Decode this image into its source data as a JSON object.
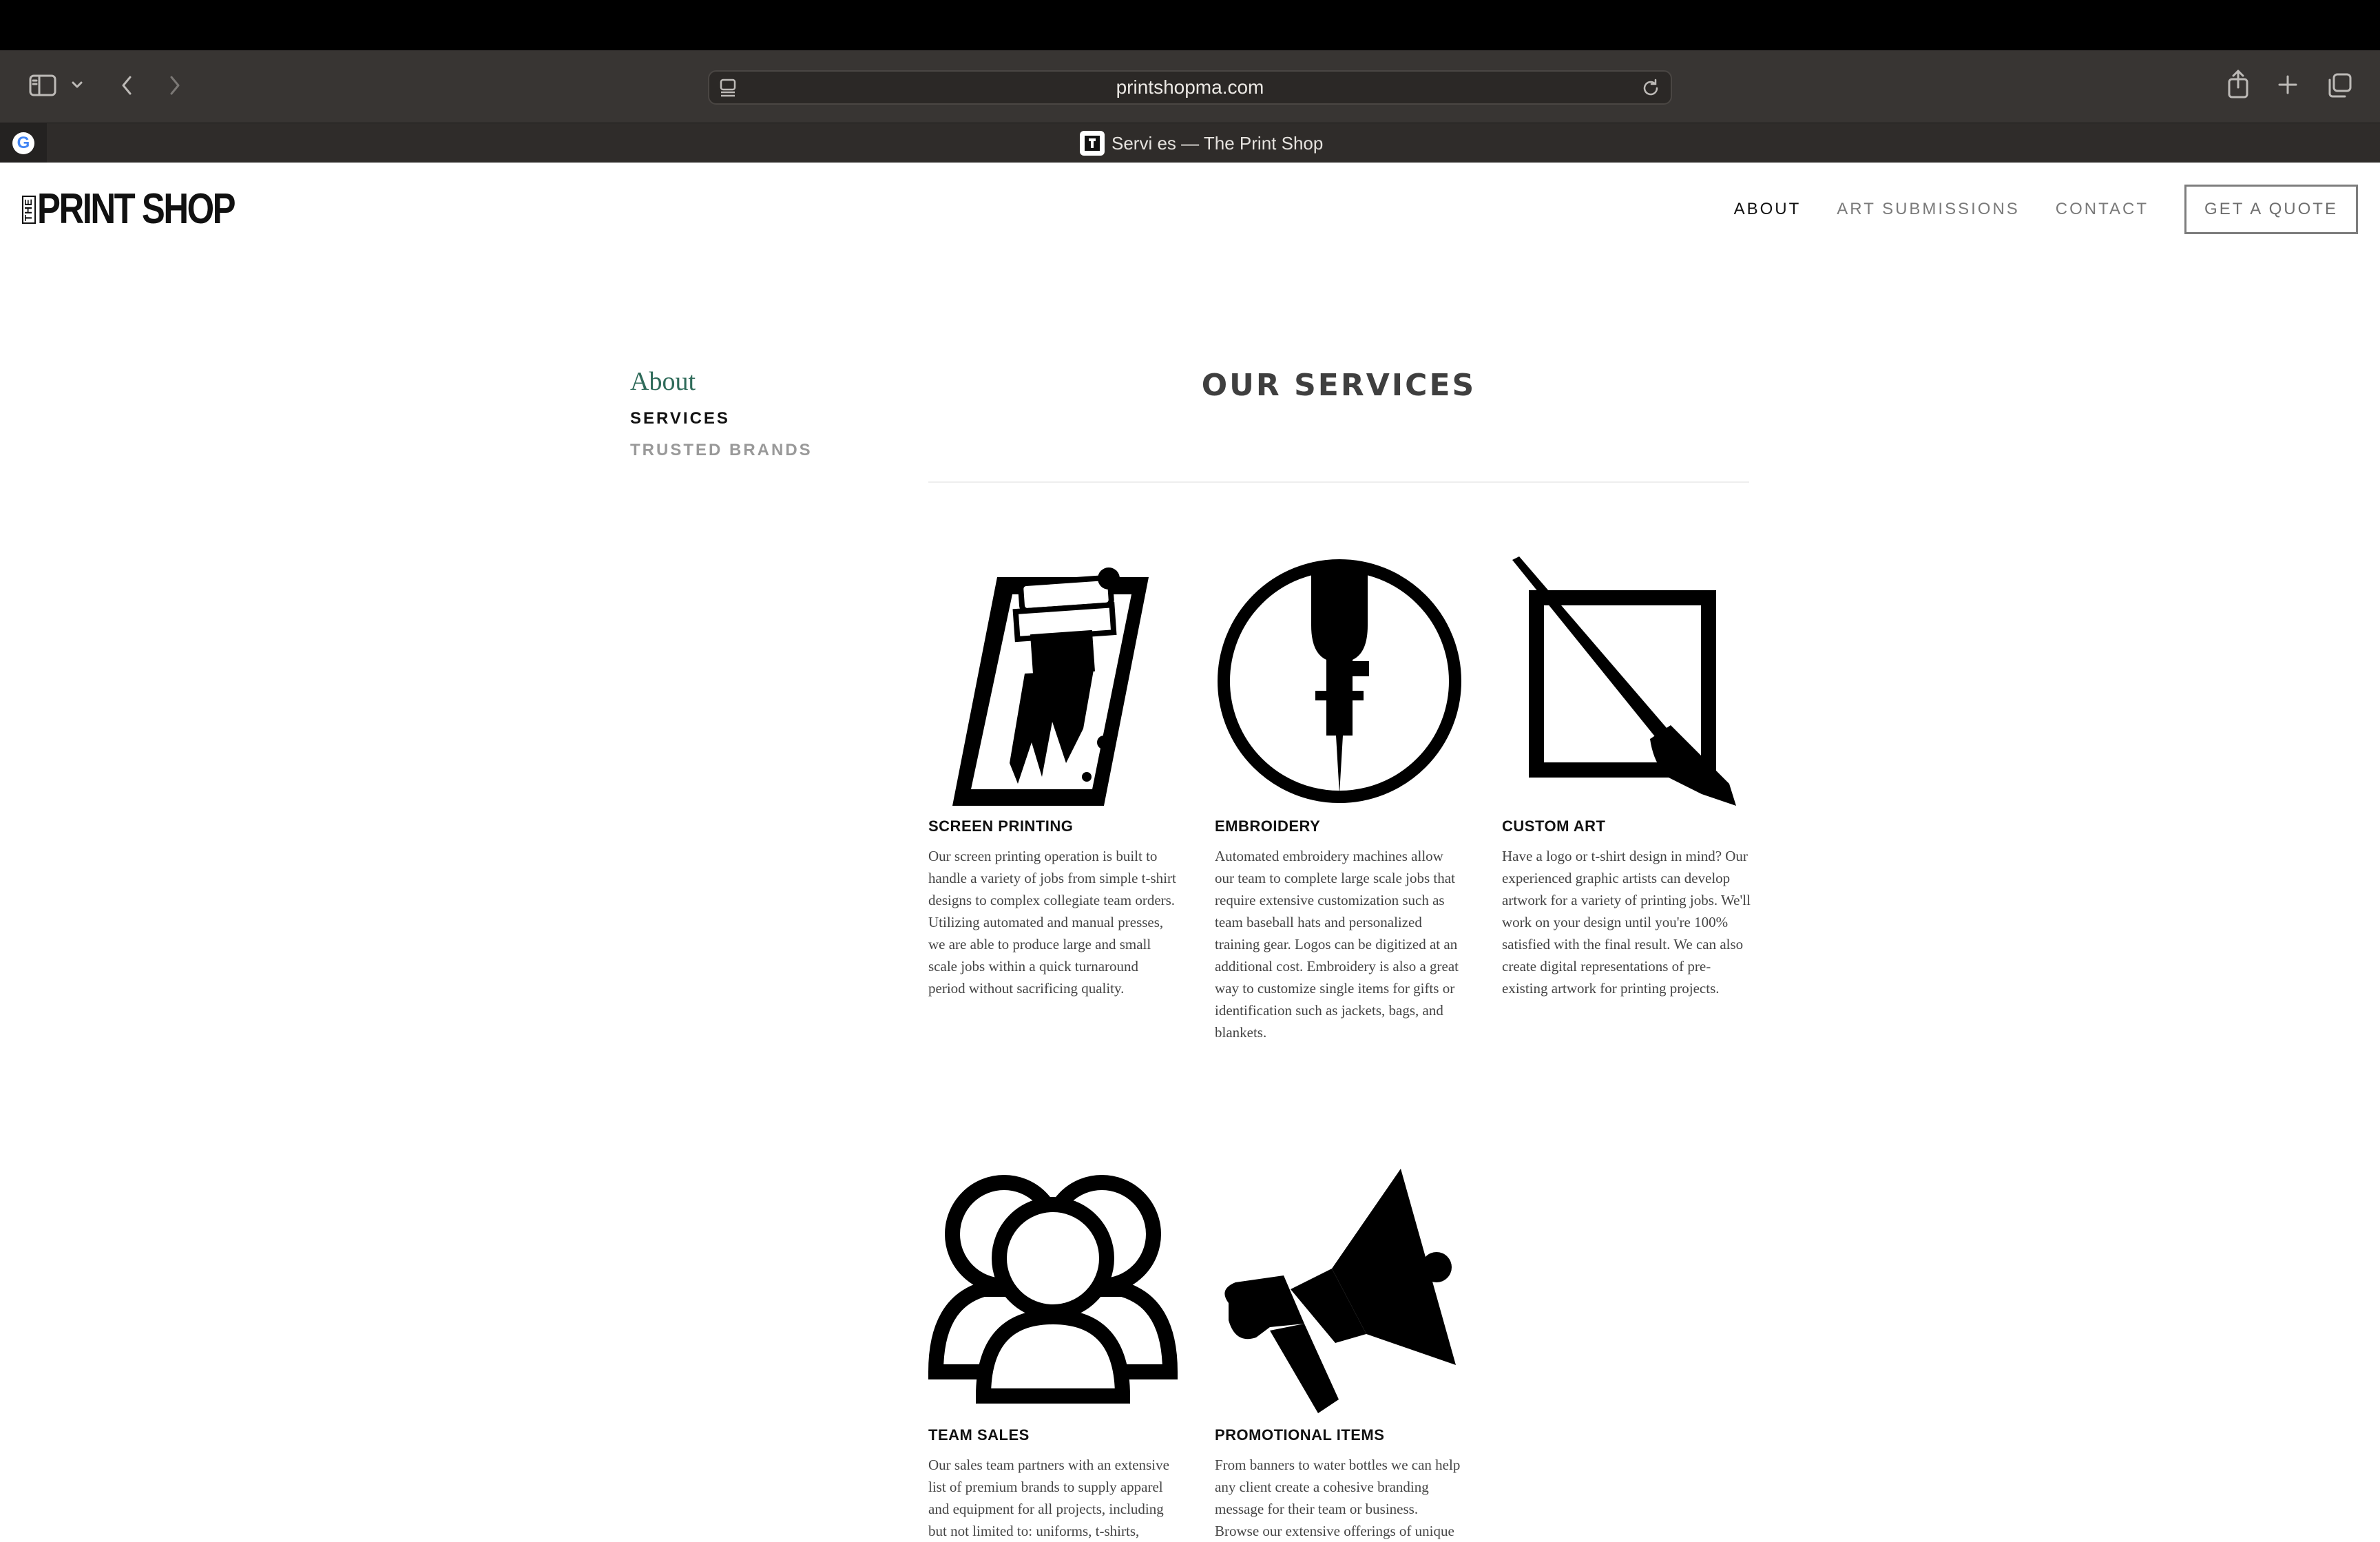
{
  "browser": {
    "url": "printshopma.com",
    "tab_title": "Servi es — The Print Shop",
    "pinned_tab_icon": "G"
  },
  "site": {
    "logo": {
      "prefix": "THE",
      "main": "PRINT SHOP"
    },
    "nav": {
      "about": "ABOUT",
      "art_submissions": "ART SUBMISSIONS",
      "contact": "CONTACT",
      "quote": "GET A QUOTE"
    }
  },
  "sidebar": {
    "title": "About",
    "items": [
      {
        "label": "SERVICES",
        "active": true
      },
      {
        "label": "TRUSTED BRANDS",
        "active": false
      }
    ]
  },
  "main": {
    "title": "OUR SERVICES",
    "services": [
      {
        "icon": "screen-printing-icon",
        "title": "SCREEN PRINTING",
        "description": "Our screen printing operation is built to handle a variety of jobs from simple t-shirt designs to complex collegiate team orders. Utilizing automated and manual presses, we are able to produce large and small scale jobs within a quick turnaround period without sacrificing quality."
      },
      {
        "icon": "embroidery-icon",
        "title": "EMBROIDERY",
        "description": "Automated embroidery machines allow our team to complete large scale jobs that require extensive customization such as team baseball hats and personalized training gear. Logos can be digitized at an additional cost. Embroidery is also a great way to customize single items for gifts or identification such as jackets, bags, and blankets."
      },
      {
        "icon": "custom-art-icon",
        "title": "CUSTOM ART",
        "description": "Have a logo or t-shirt design in mind? Our experienced graphic artists can develop artwork for a variety of printing jobs. We'll work on your design until you're 100% satisfied with the final result. We can also create digital representations of pre-existing artwork for printing projects."
      },
      {
        "icon": "team-sales-icon",
        "title": "TEAM SALES",
        "description": "Our sales team partners with an extensive list of premium brands to supply apparel and equipment for all projects, including but not limited to: uniforms, t-shirts,"
      },
      {
        "icon": "megaphone-icon",
        "title": "PROMOTIONAL ITEMS",
        "description": "From banners to water bottles we can help any client create a cohesive branding message for their team or business. Browse our extensive offerings of unique"
      }
    ]
  }
}
